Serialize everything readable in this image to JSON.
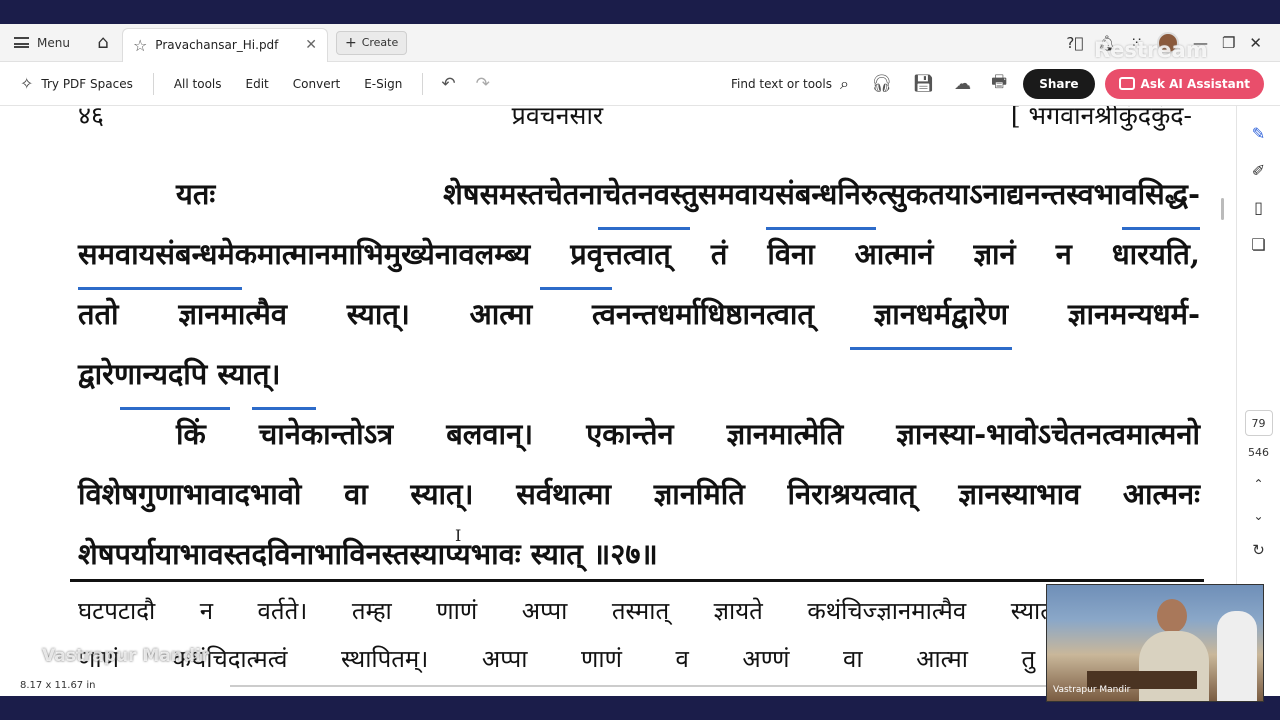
{
  "topbar": {
    "menu_label": "Menu",
    "tab_title": "Pravachansar_Hi.pdf",
    "create_label": "Create",
    "watermark": "Restream"
  },
  "toolbar": {
    "try_spaces": "Try PDF Spaces",
    "all_tools": "All tools",
    "edit": "Edit",
    "convert": "Convert",
    "esign": "E-Sign",
    "find": "Find text or tools",
    "share": "Share",
    "ai_assistant": "Ask AI Assistant"
  },
  "document": {
    "header": {
      "page_number": "४६",
      "title": "प्रवचनसार",
      "right": "[ भगवानश्रीकुंदकुंद-"
    },
    "lines": [
      "यतः      शेषसमस्तचेतनाचेतनवस्तुसमवायसंबन्धनिरुत्सुकतयाऽनाद्यनन्तस्वभावसिद्ध-",
      "समवायसंबन्धमेकमात्मानमाभिमुख्येनावलम्ब्य प्रवृत्तत्वात् तं विना आत्मानं ज्ञानं न धारयति,",
      "ततो ज्ञानमात्मैव स्यात्। आत्मा त्वनन्तधर्माधिष्ठानत्वात् ज्ञानधर्मद्वारेण ज्ञानमन्यधर्म-",
      "द्वारेणान्यदपि स्यात्।",
      "किं चानेकान्तोऽत्र बलवान्। एकान्तेन ज्ञानमात्मेति ज्ञानस्या-भावोऽचेतनत्वमात्मनो",
      "विशेषगुणाभावादभावो वा स्यात्। सर्वथात्मा ज्ञानमिति निराश्रयत्वात् ज्ञानस्याभाव आत्मनः",
      "शेषपर्यायाभावस्तदविनाभाविनस्तस्याप्यभावः स्यात् ॥२७॥"
    ],
    "footnotes": [
      "घटपटादौ न वर्तते। तम्हा णाणं अप्पा तस्मात् ज्ञायते कथंचिज्ज्ञानमात्मैव स्यात्। इति स",
      "णाणं कथंचिदात्मत्वं  स्थापितम्। अप्पा णाणं व अण्णं वा आत्मा तु ज्ञानधर्मद्वारेण"
    ]
  },
  "right_rail": {
    "current_page": "79",
    "total_pages": "546"
  },
  "status": {
    "page_size": "8.17 x 11.67 in"
  },
  "overlay": {
    "stream_label": "Vastrapur Mandir",
    "camera_caption": "Vastrapur Mandir"
  },
  "colors": {
    "highlight": "#2d6bc9",
    "ai_button": "#e94e6b",
    "share_button": "#1a1a1a"
  }
}
